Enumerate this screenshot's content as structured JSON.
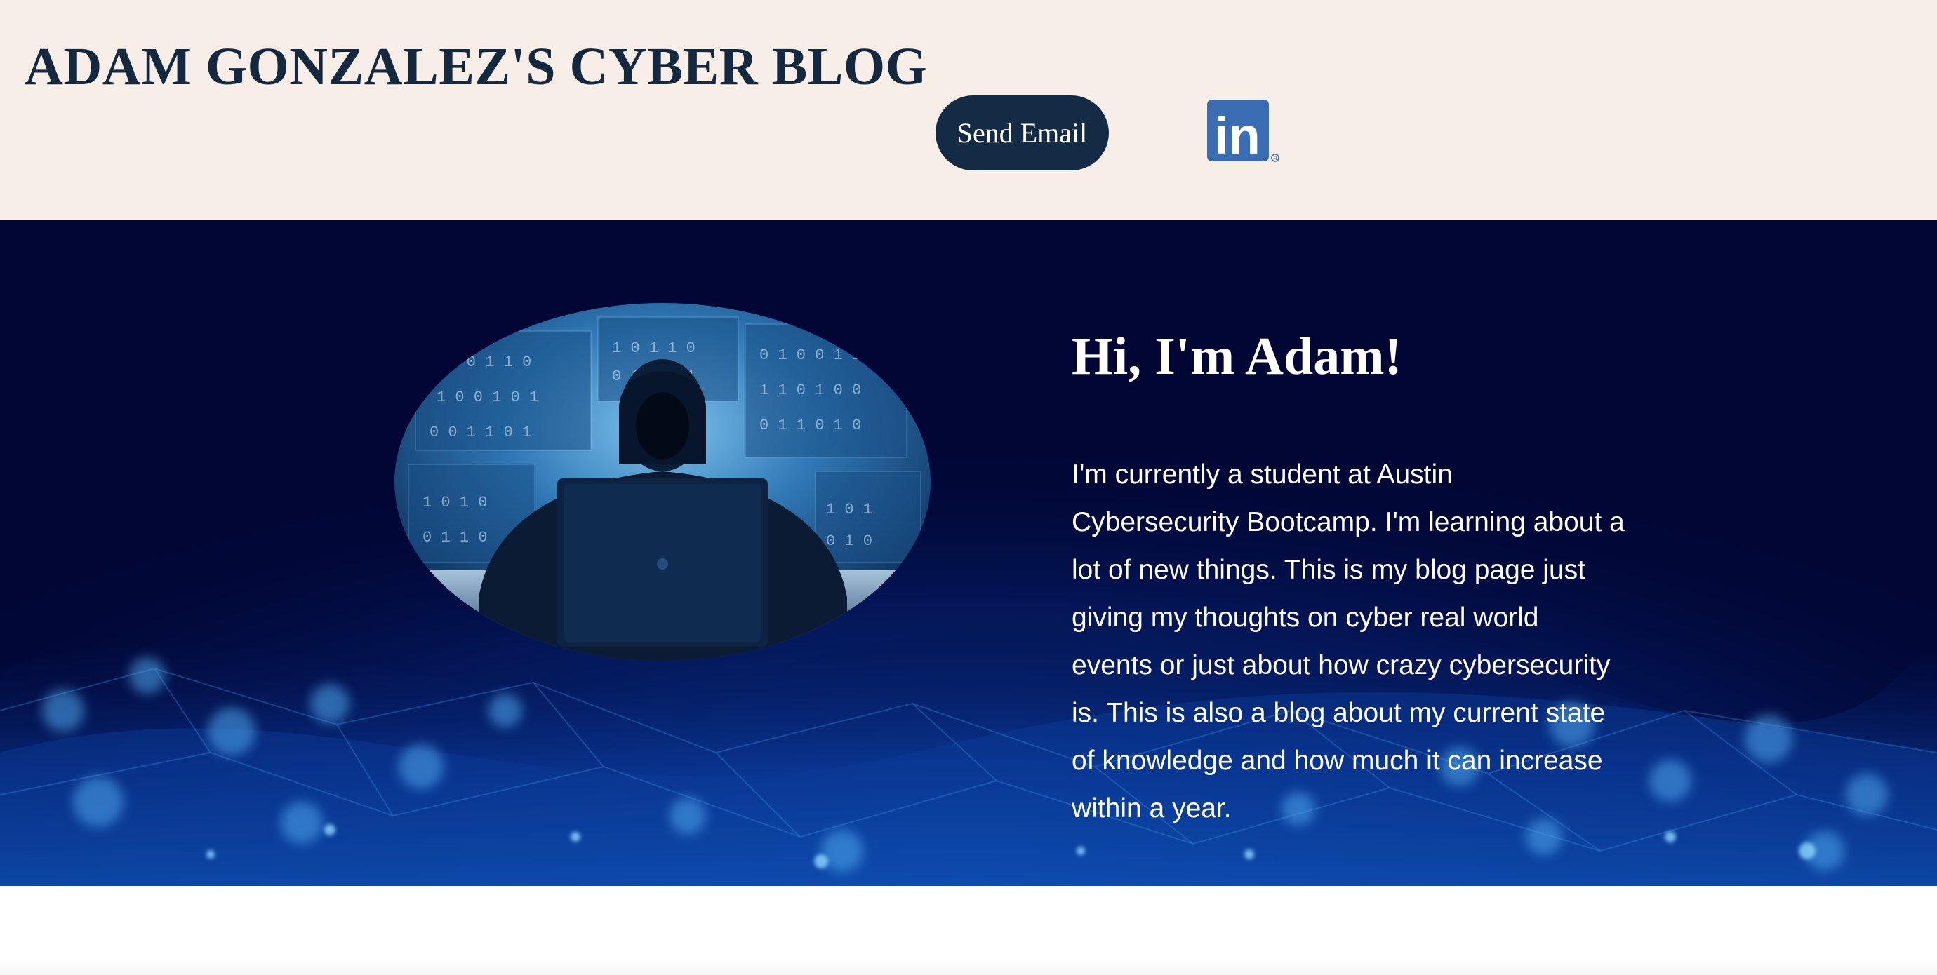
{
  "header": {
    "title": "ADAM GONZALEZ'S CYBER BLOG",
    "email_button_label": "Send Email",
    "linkedin_icon_text": "in",
    "background_color": "#f7efe7",
    "title_color": "#14283f",
    "button_color": "#132b44",
    "linkedin_color": "#3b6db4"
  },
  "hero": {
    "heading": "Hi, I'm Adam!",
    "body": "I'm currently a student at Austin Cybersecurity Bootcamp. I'm learning about a lot of new things. This is my blog page just giving my thoughts on cyber real world events or just about how crazy cybersecurity is. This is also a blog about my current state of knowledge and how much it can increase within a year.",
    "background_color": "#010634",
    "photo_subject": "hooded-hacker-at-laptop"
  }
}
